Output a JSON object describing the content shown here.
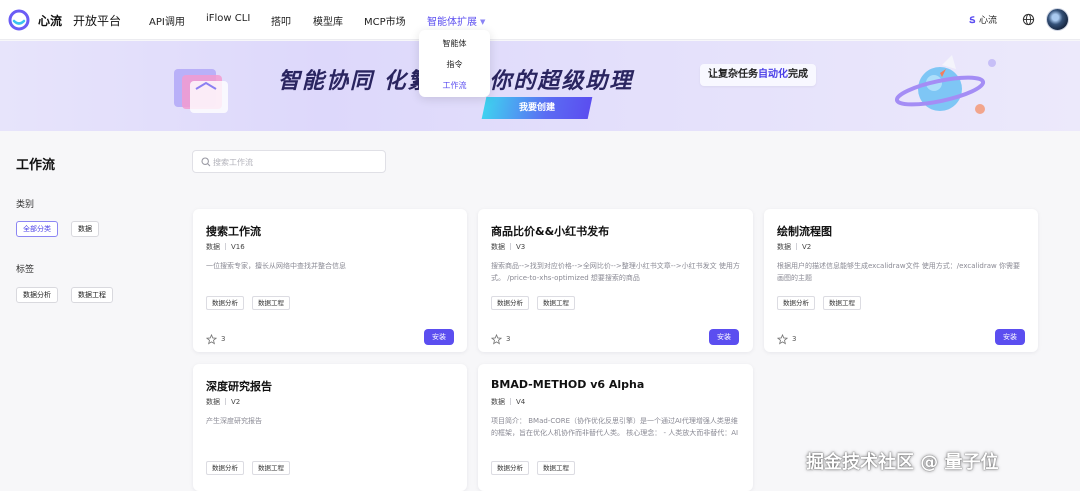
{
  "brand": {
    "name": "心流",
    "subtitle": "开放平台"
  },
  "nav": {
    "items": [
      {
        "label": "API调用"
      },
      {
        "label": "iFlow CLI"
      },
      {
        "label": "搭叩"
      },
      {
        "label": "模型库"
      },
      {
        "label": "MCP市场"
      },
      {
        "label": "智能体扩展",
        "active": true
      }
    ],
    "dropdown": [
      "智能体",
      "指令",
      "工作流"
    ],
    "dropdown_active": "工作流",
    "right_link": "心流"
  },
  "banner": {
    "title": "智能协同 化繁      构建你的超级助理",
    "pill_prefix": "让复杂任务",
    "pill_highlight": "自动化",
    "pill_suffix": "完成",
    "cta": "我要创建"
  },
  "sidebar": {
    "title": "工作流",
    "category_label": "类别",
    "categories": [
      "全部分类",
      "数据"
    ],
    "selected_category": "全部分类",
    "tag_label": "标签",
    "tags": [
      "数据分析",
      "数据工程"
    ]
  },
  "search": {
    "placeholder": "搜索工作流",
    "value": ""
  },
  "cards": [
    {
      "title": "搜索工作流",
      "category": "数据",
      "version": "V16",
      "desc": "一位搜索专家，擅长从网络中查找并整合信息",
      "tags": [
        "数据分析",
        "数据工程"
      ],
      "stars": "3",
      "install": "安装"
    },
    {
      "title": "商品比价&&小红书发布",
      "category": "数据",
      "version": "V3",
      "desc": "搜索商品-->找到对应价格-->全网比价-->整理小红书文章-->小红书发文 使用方式。 /price-to-xhs-optimized 想要搜索的商品",
      "tags": [
        "数据分析",
        "数据工程"
      ],
      "stars": "3",
      "install": "安装"
    },
    {
      "title": "绘制流程图",
      "category": "数据",
      "version": "V2",
      "desc": "根据用户的描述信息能够生成excalidraw文件 使用方式：/excalidraw 你需要画图的主题",
      "tags": [
        "数据分析",
        "数据工程"
      ],
      "stars": "3",
      "install": "安装"
    },
    {
      "title": "深度研究报告",
      "category": "数据",
      "version": "V2",
      "desc": "产生深度研究报告",
      "tags": [
        "数据分析",
        "数据工程"
      ]
    },
    {
      "title": "BMAD-METHOD v6 Alpha",
      "category": "数据",
      "version": "V4",
      "desc": "项目简介： BMad-CORE（协作优化反思引擎）是一个通过AI代理增强人类思维的框架，旨在优化人机协作而非替代人类。 核心理念： - 人类放大而非替代：AI代理作为专家教练和合作者，引导用户发现灵...",
      "tags": [
        "数据分析",
        "数据工程"
      ]
    }
  ],
  "watermark": "掘金技术社区 @ 量子位",
  "colors": {
    "accent": "#5b4ef0",
    "background": "#f7f7f9",
    "card": "#ffffff"
  }
}
